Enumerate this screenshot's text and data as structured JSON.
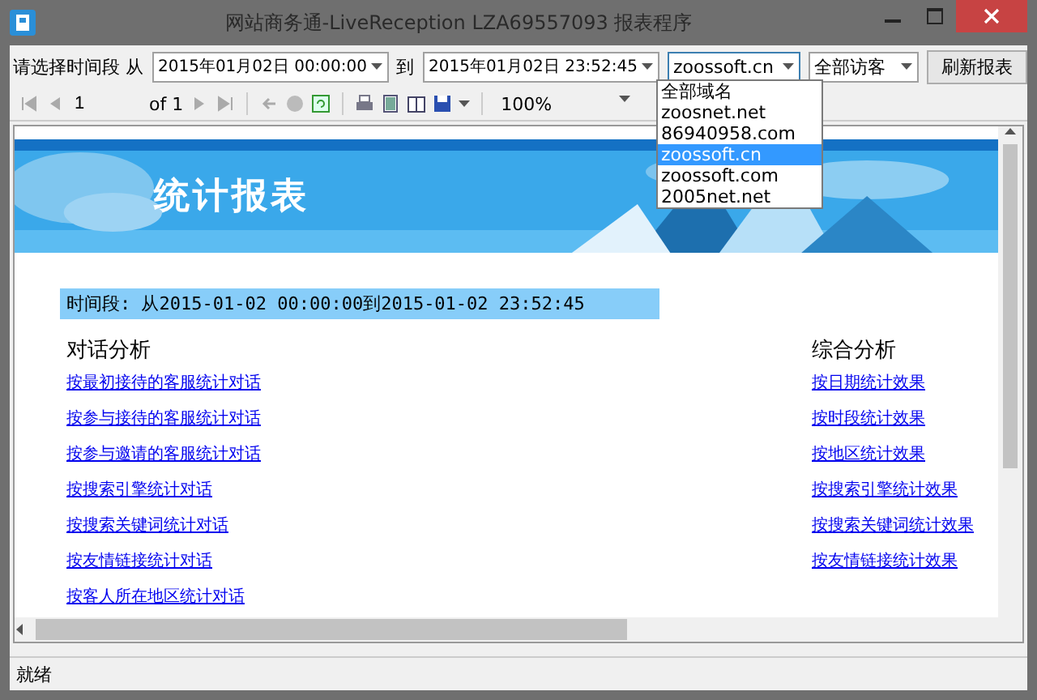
{
  "window": {
    "title": "网站商务通-LiveReception LZA69557093  报表程序"
  },
  "filter": {
    "range_label": "请选择时间段 从",
    "from": "2015年01月02日 00:00:00",
    "to_label": "到",
    "to": "2015年01月02日 23:52:45",
    "domain": "zoossoft.cn",
    "visitors": "全部访客",
    "refresh": "刷新报表"
  },
  "domain_options": [
    {
      "label": "全部域名",
      "selected": false
    },
    {
      "label": "zoosnet.net",
      "selected": false
    },
    {
      "label": "86940958.com",
      "selected": false
    },
    {
      "label": "zoossoft.cn",
      "selected": true
    },
    {
      "label": "zoossoft.com",
      "selected": false
    },
    {
      "label": "2005net.net",
      "selected": false
    }
  ],
  "report_toolbar": {
    "page": "1",
    "of": "of 1",
    "zoom": "100%"
  },
  "report": {
    "banner_title": "统计报表",
    "period": "时间段: 从2015-01-02 00:00:00到2015-01-02 23:52:45",
    "sections": [
      {
        "heading": "对话分析",
        "links": [
          "按最初接待的客服统计对话",
          "按参与接待的客服统计对话",
          "按参与邀请的客服统计对话",
          "按搜索引擎统计对话",
          "按搜索关键词统计对话",
          "按友情链接统计对话",
          "按客人所在地区统计对话"
        ]
      },
      {
        "heading": "综合分析",
        "links": [
          "按日期统计效果",
          "按时段统计效果",
          "按地区统计效果",
          "按搜索引擎统计效果",
          "按搜索关键词统计效果",
          "按友情链接统计效果"
        ]
      }
    ]
  },
  "status_bar": {
    "text": "就绪"
  }
}
